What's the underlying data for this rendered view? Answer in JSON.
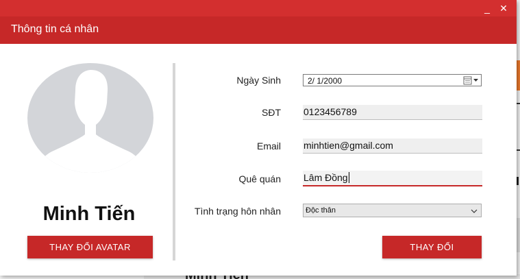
{
  "window": {
    "minimize_glyph": "_",
    "close_glyph": "✕"
  },
  "header": {
    "title": "Thông tin cá nhân"
  },
  "profile": {
    "avatar_icon": "user-silhouette-icon",
    "name": "Minh Tiến",
    "change_avatar_label": "THAY ĐỔI AVATAR"
  },
  "form": {
    "birthdate": {
      "label": "Ngày Sinh",
      "value": "2/  1/2000"
    },
    "phone": {
      "label": "SĐT",
      "value": "0123456789"
    },
    "email": {
      "label": "Email",
      "value": "minhtien@gmail.com"
    },
    "hometown": {
      "label": "Quê quán",
      "value": "Lâm Đồng"
    },
    "marital": {
      "label": "Tình trạng hôn nhân",
      "value": "Độc thân"
    },
    "save_label": "THAY ĐỔI"
  },
  "background": {
    "partial_text": "Minh Tiến"
  },
  "colors": {
    "accent": "#c62828",
    "titlebar": "#d32f2f"
  }
}
